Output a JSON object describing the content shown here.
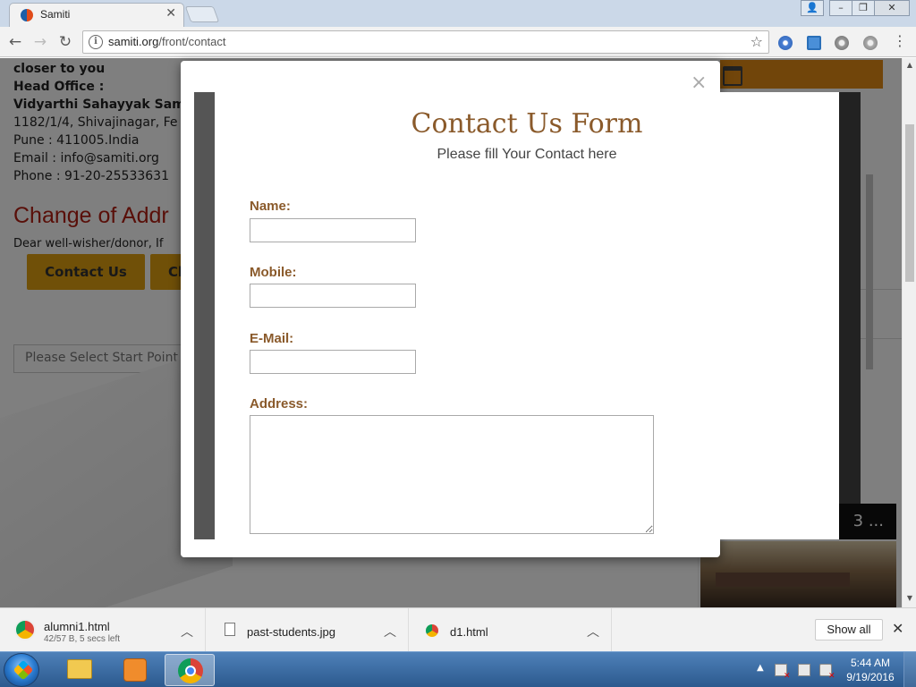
{
  "browser": {
    "tab_title": "Samiti",
    "url_host": "samiti.org",
    "url_path": "/front/contact"
  },
  "page": {
    "lines": [
      {
        "text": "closer to you",
        "bold": true
      },
      {
        "text": "Head Office :",
        "bold": true
      },
      {
        "text": "Vidyarthi Sahayyak Sam",
        "bold": true
      },
      {
        "text": "1182/1/4, Shivajinagar, Fe",
        "bold": false
      },
      {
        "text": "Pune : 411005.India",
        "bold": false
      },
      {
        "text": "Email : info@samiti.org",
        "bold": false
      },
      {
        "text": "Phone : 91-20-25533631",
        "bold": false
      }
    ],
    "change_heading": "Change of Addr",
    "dear_text": "Dear well-wisher/donor, If",
    "contact_btn": "Contact Us",
    "second_btn": "Cl",
    "start_placeholder": "Please Select Start Point",
    "video_caption": "3 ..."
  },
  "modal": {
    "close": "×",
    "title": "Contact Us Form",
    "subtitle": "Please fill Your Contact here",
    "fields": {
      "name_label": "Name:",
      "mobile_label": "Mobile:",
      "email_label": "E-Mail:",
      "address_label": "Address:"
    }
  },
  "downloads": {
    "items": [
      {
        "name": "alumni1.html",
        "status": "42/57 B, 5 secs left",
        "icon": "chrome-icon"
      },
      {
        "name": "past-students.jpg",
        "status": "",
        "icon": "file-icon"
      },
      {
        "name": "d1.html",
        "status": "",
        "icon": "chrome-icon"
      }
    ],
    "show_all": "Show all",
    "close": "✕"
  },
  "taskbar": {
    "time": "5:44 AM",
    "date": "9/19/2016"
  }
}
